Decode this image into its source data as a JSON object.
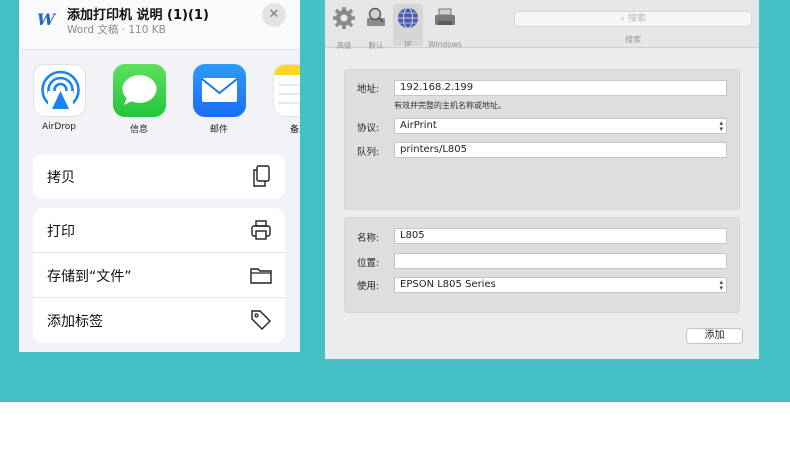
{
  "share_sheet": {
    "doc_icon_letter": "W",
    "doc_title": "添加打印机 说明 (1)(1)",
    "doc_subtitle": "Word 文稿 · 110 KB",
    "close_symbol": "✕",
    "apps": [
      {
        "label": "AirDrop",
        "icon": "airdrop-icon"
      },
      {
        "label": "信息",
        "icon": "messages-icon"
      },
      {
        "label": "邮件",
        "icon": "mail-icon"
      },
      {
        "label": "备忘",
        "icon": "notes-icon"
      }
    ],
    "actions_group1": [
      {
        "label": "拷贝",
        "icon": "copy-icon"
      }
    ],
    "actions_group2": [
      {
        "label": "打印",
        "icon": "printer-icon"
      },
      {
        "label": "存储到“文件”",
        "icon": "folder-icon"
      },
      {
        "label": "添加标签",
        "icon": "tag-icon"
      }
    ]
  },
  "add_printer": {
    "toolbar": [
      {
        "label": "高级",
        "icon": "gear-icon"
      },
      {
        "label": "默认",
        "icon": "default-printer-icon"
      },
      {
        "label": "IP",
        "icon": "globe-icon"
      },
      {
        "label": "Windows",
        "icon": "windows-printer-icon"
      }
    ],
    "search_placeholder": "搜索",
    "search_caption": "搜索",
    "address_label": "地址:",
    "address_value": "192.168.2.199",
    "address_hint": "有效并完整的主机名称或地址。",
    "protocol_label": "协议:",
    "protocol_value": "AirPrint",
    "queue_label": "队列:",
    "queue_value": "printers/L805",
    "name_label": "名称:",
    "name_value": "L805",
    "location_label": "位置:",
    "location_value": "",
    "use_label": "使用:",
    "use_value": "EPSON L805 Series",
    "add_button": "添加"
  },
  "colors": {
    "background_teal": "#44c1c5",
    "ios_blue": "#1e66c9",
    "mac_panel": "#dedede"
  }
}
